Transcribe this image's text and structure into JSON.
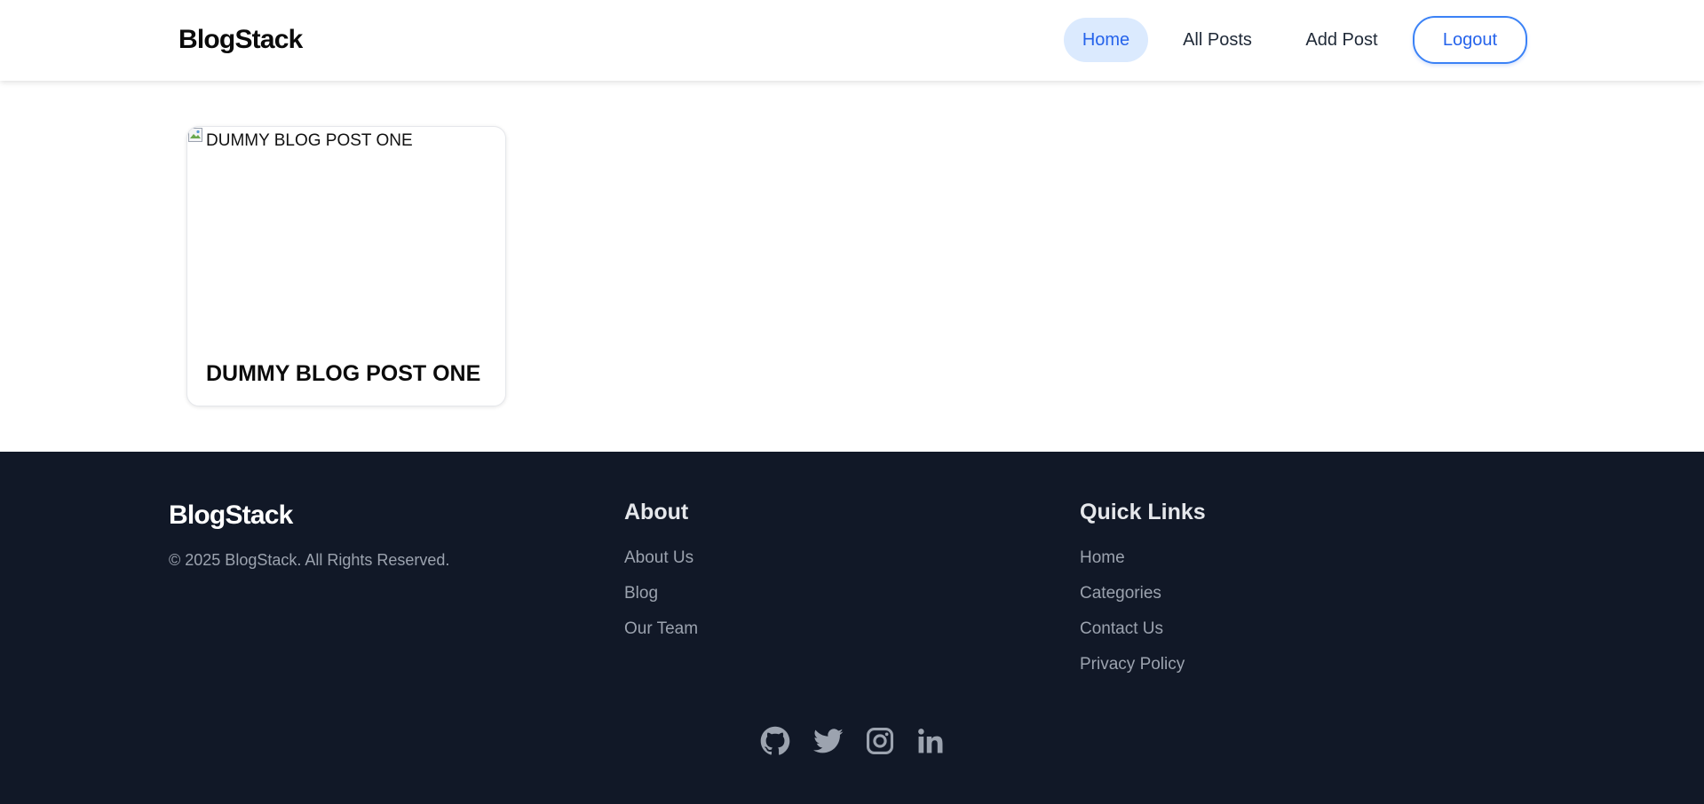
{
  "header": {
    "brand": "BlogStack",
    "nav": {
      "home": "Home",
      "all_posts": "All Posts",
      "add_post": "Add Post",
      "logout": "Logout"
    }
  },
  "posts": [
    {
      "image_alt": "DUMMY BLOG POST ONE",
      "title": "DUMMY BLOG POST ONE"
    }
  ],
  "footer": {
    "brand": "BlogStack",
    "copyright": "© 2025 BlogStack. All Rights Reserved.",
    "about": {
      "title": "About",
      "links": [
        "About Us",
        "Blog",
        "Our Team"
      ]
    },
    "quick_links": {
      "title": "Quick Links",
      "links": [
        "Home",
        "Categories",
        "Contact Us",
        "Privacy Policy"
      ]
    },
    "social": [
      "github-icon",
      "twitter-icon",
      "instagram-icon",
      "linkedin-icon"
    ]
  },
  "colors": {
    "accent": "#2563eb",
    "active_nav_bg": "#dbeafe",
    "footer_bg": "#111827",
    "footer_text": "#9ca3af"
  }
}
